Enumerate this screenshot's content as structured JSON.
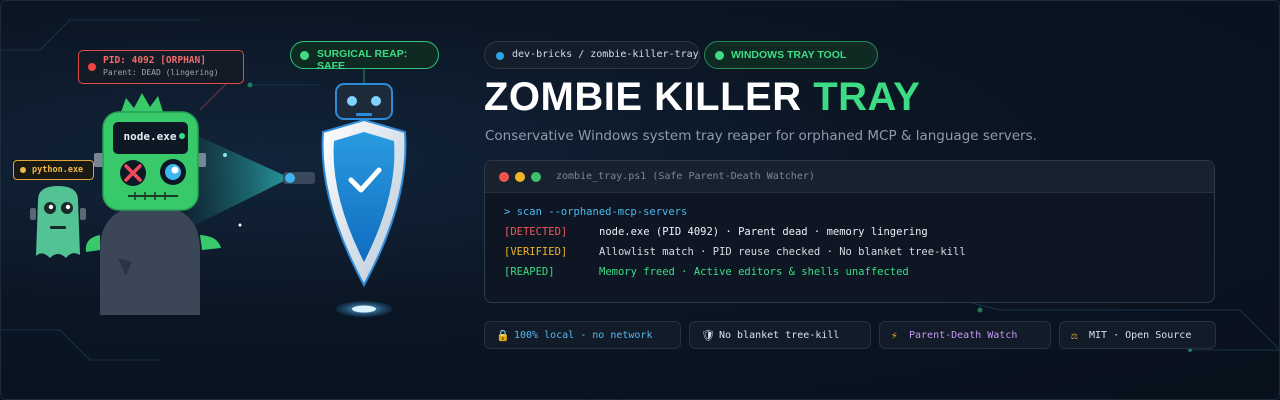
{
  "scene": {
    "pid_tag": {
      "title": "PID: 4092 [ORPHAN]",
      "subtitle": "Parent: DEAD (lingering)"
    },
    "reap_tag": "SURGICAL REAP: SAFE",
    "python_tag": "python.exe",
    "node_screen": "node.exe"
  },
  "header": {
    "breadcrumb": "dev-bricks / zombie-killer-tray",
    "badge": "WINDOWS TRAY TOOL",
    "title_main": "ZOMBIE KILLER",
    "title_accent": "TRAY",
    "subtitle": "Conservative Windows system tray reaper for orphaned MCP & language servers."
  },
  "terminal": {
    "title": "zombie_tray.ps1 (Safe Parent-Death Watcher)",
    "command": "> scan --orphaned-mcp-servers",
    "rows": [
      {
        "tag": "[DETECTED]",
        "message": "node.exe (PID 4092) · Parent dead · memory lingering"
      },
      {
        "tag": "[VERIFIED]",
        "message": "Allowlist match · PID reuse checked · No blanket tree-kill"
      },
      {
        "tag": "[REAPED]",
        "message": "Memory freed · Active editors & shells unaffected"
      }
    ]
  },
  "features": [
    {
      "icon": "lock-icon",
      "label": "100% local - no network"
    },
    {
      "icon": "shield-icon",
      "label": "No blanket tree-kill"
    },
    {
      "icon": "lightning-icon",
      "label": "Parent-Death Watch"
    },
    {
      "icon": "scale-icon",
      "label": "MIT · Open Source"
    }
  ],
  "colors": {
    "accent_green": "#3ddc84",
    "danger_red": "#ef5a5a",
    "warning_yellow": "#f0b429",
    "info_blue": "#4ab8ee",
    "background": "#0b1624"
  }
}
